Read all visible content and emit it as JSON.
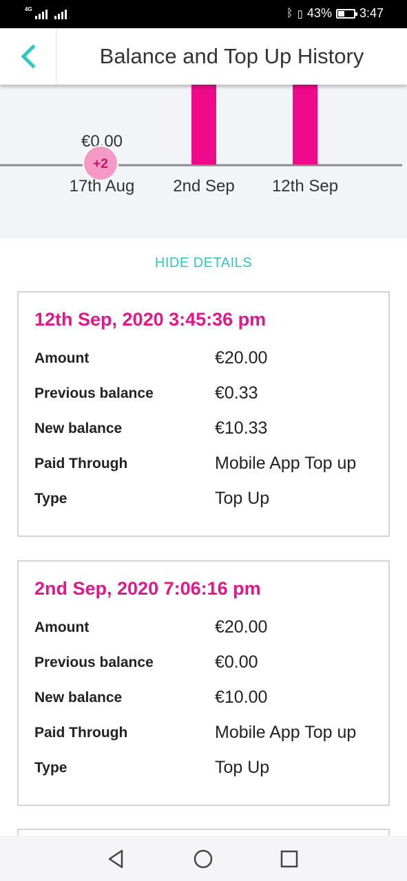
{
  "status": {
    "net1_label": "4G",
    "battery_pct": "43%",
    "battery_level": 0.43,
    "time": "3:47"
  },
  "header": {
    "title": "Balance and Top Up History",
    "back_icon": "chevron-left-icon"
  },
  "chart_data": {
    "type": "bar",
    "categories": [
      "17th Aug",
      "2nd Sep",
      "12th Sep"
    ],
    "value_label": "€0.00",
    "badge": "+2",
    "bar_color": "#ee0a8b"
  },
  "actions": {
    "hide_details": "HIDE DETAILS"
  },
  "transactions": [
    {
      "datetime": "12th Sep, 2020 3:45:36 pm",
      "rows": [
        {
          "label": "Amount",
          "value": "€20.00"
        },
        {
          "label": "Previous balance",
          "value": "€0.33"
        },
        {
          "label": "New balance",
          "value": "€10.33"
        },
        {
          "label": "Paid Through",
          "value": "Mobile App Top up"
        },
        {
          "label": "Type",
          "value": "Top Up"
        }
      ]
    },
    {
      "datetime": "2nd Sep, 2020 7:06:16 pm",
      "rows": [
        {
          "label": "Amount",
          "value": "€20.00"
        },
        {
          "label": "Previous balance",
          "value": "€0.00"
        },
        {
          "label": "New balance",
          "value": "€10.00"
        },
        {
          "label": "Paid Through",
          "value": "Mobile App Top up"
        },
        {
          "label": "Type",
          "value": "Top Up"
        }
      ]
    }
  ],
  "colors": {
    "accent": "#2ec6c6",
    "pink": "#e0188a"
  }
}
